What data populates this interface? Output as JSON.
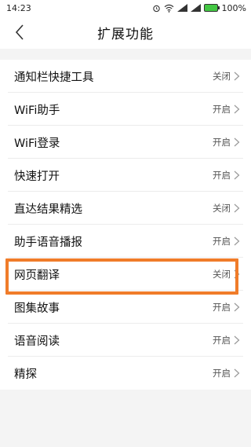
{
  "status_bar": {
    "time": "14:23",
    "battery_percent": "100%"
  },
  "header": {
    "title": "扩展功能"
  },
  "settings": [
    {
      "label": "通知栏快捷工具",
      "value": "关闭"
    },
    {
      "label": "WiFi助手",
      "value": "开启"
    },
    {
      "label": "WiFi登录",
      "value": "开启"
    },
    {
      "label": "快速打开",
      "value": "开启"
    },
    {
      "label": "直达结果精选",
      "value": "关闭"
    },
    {
      "label": "助手语音播报",
      "value": "开启"
    },
    {
      "label": "网页翻译",
      "value": "关闭"
    },
    {
      "label": "图集故事",
      "value": "开启"
    },
    {
      "label": "语音阅读",
      "value": "开启"
    },
    {
      "label": "精探",
      "value": "开启"
    }
  ],
  "highlight_color": "#f07c2a"
}
